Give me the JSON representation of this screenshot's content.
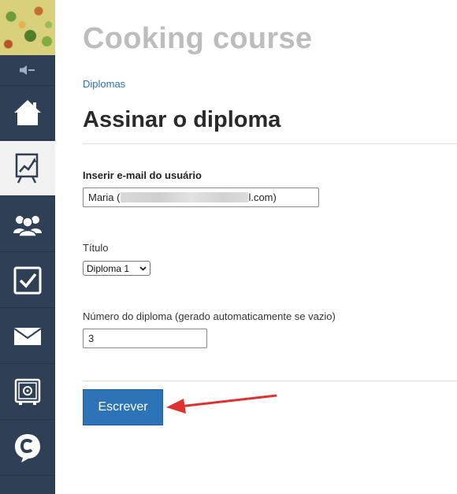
{
  "app": {
    "title": "Cooking course"
  },
  "breadcrumb": {
    "label": "Diplomas"
  },
  "page": {
    "title": "Assinar o diploma"
  },
  "sidebar": {
    "items": [
      {
        "icon": "home-icon",
        "active": false
      },
      {
        "icon": "presentation-chart-icon",
        "active": true
      },
      {
        "icon": "users-icon",
        "active": false
      },
      {
        "icon": "checkbox-icon",
        "active": false
      },
      {
        "icon": "envelope-icon",
        "active": false
      },
      {
        "icon": "safe-icon",
        "active": false
      },
      {
        "icon": "chat-c-icon",
        "active": false
      }
    ]
  },
  "form": {
    "email": {
      "label": "Inserir e-mail do usuário",
      "value_prefix": "Maria (",
      "value_suffix": "l.com)"
    },
    "title_field": {
      "label": "Título",
      "selected": "Diploma 1"
    },
    "number_field": {
      "label": "Número do diploma (gerado automaticamente se vazio)",
      "value": "3"
    },
    "submit_label": "Escrever"
  },
  "colors": {
    "sidebar": "#2f3f55",
    "accent": "#2d73b8",
    "link": "#2a72b5",
    "annotation_arrow": "#e03030"
  }
}
